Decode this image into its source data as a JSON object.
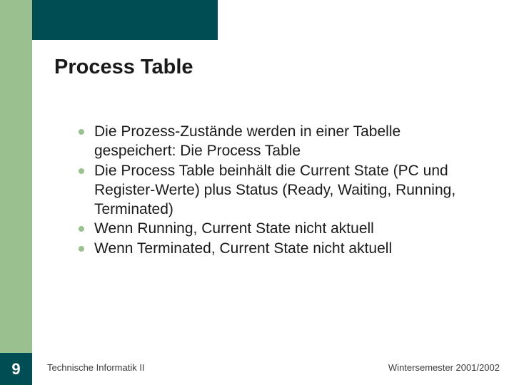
{
  "slide": {
    "title": "Process Table",
    "bullets": [
      "Die Prozess-Zustände werden in einer Tabelle gespeichert: Die Process Table",
      "Die Process Table beinhält die Current State (PC und Register-Werte) plus Status (Ready, Waiting, Running, Terminated)",
      "Wenn Running, Current State nicht aktuell",
      "Wenn Terminated, Current State nicht aktuell"
    ],
    "page_number": "9"
  },
  "footer": {
    "course": "Technische Informatik II",
    "term": "Wintersemester 2001/2002"
  },
  "colors": {
    "sidebar": "#9bc08f",
    "accent_dark": "#004d54"
  }
}
